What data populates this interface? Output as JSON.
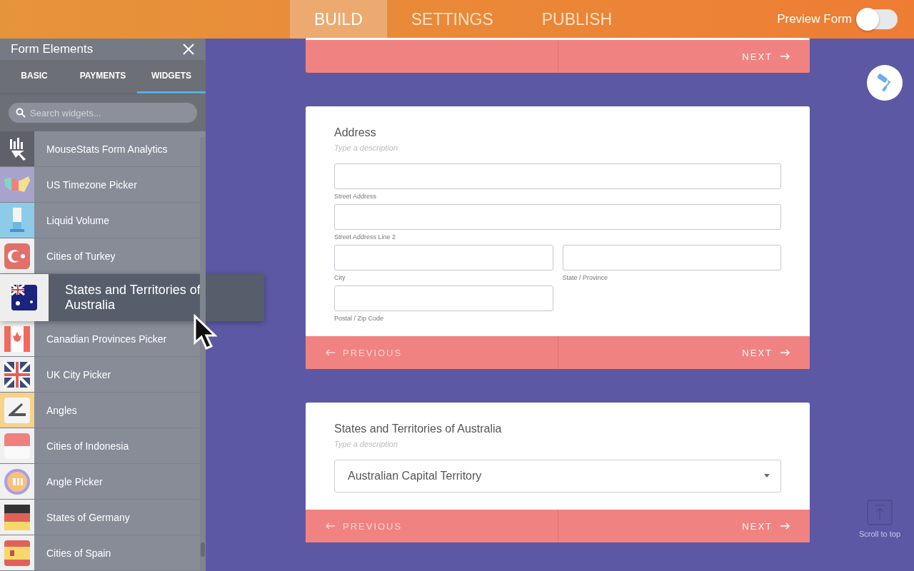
{
  "top_tabs": [
    {
      "label": "BUILD",
      "selected": true
    },
    {
      "label": "SETTINGS",
      "selected": false
    },
    {
      "label": "PUBLISH",
      "selected": false
    }
  ],
  "preview": {
    "label": "Preview Form",
    "on": false
  },
  "sidebar": {
    "title": "Form Elements",
    "tabs": [
      {
        "label": "BASIC",
        "selected": false
      },
      {
        "label": "PAYMENTS",
        "selected": false
      },
      {
        "label": "WIDGETS",
        "selected": true
      }
    ],
    "search": {
      "placeholder": "Search widgets..."
    },
    "items": [
      {
        "label": "MouseStats Form Analytics",
        "kind": "bars",
        "dragging": false
      },
      {
        "label": "US Timezone Picker",
        "kind": "usmap",
        "dragging": false
      },
      {
        "label": "Liquid Volume",
        "kind": "beaker",
        "dragging": false
      },
      {
        "label": "Cities of Turkey",
        "kind": "turkey",
        "dragging": false
      },
      {
        "label": "States and Territories of Australia",
        "kind": "australia",
        "dragging": true
      },
      {
        "label": "Canadian Provinces Picker",
        "kind": "canada",
        "dragging": false
      },
      {
        "label": "UK City Picker",
        "kind": "uk",
        "dragging": false
      },
      {
        "label": "Angles",
        "kind": "angle",
        "dragging": false
      },
      {
        "label": "Cities of Indonesia",
        "kind": "indonesia",
        "dragging": false
      },
      {
        "label": "Angle Picker",
        "kind": "degrees",
        "dragging": false
      },
      {
        "label": "States of Germany",
        "kind": "germany",
        "dragging": false
      },
      {
        "label": "Cities of Spain",
        "kind": "spain",
        "dragging": false
      }
    ]
  },
  "cards": [
    {
      "kind": "footer_only",
      "footer": {
        "next": "NEXT"
      }
    },
    {
      "kind": "address",
      "title": "Address",
      "description": "Type a description",
      "fields": [
        {
          "label": "Street Address",
          "kind": "full"
        },
        {
          "label": "Street Address Line 2",
          "kind": "full"
        },
        {
          "label": "City",
          "kind": "half"
        },
        {
          "label": "State / Province",
          "kind": "half"
        },
        {
          "label": "Postal / Zip Code",
          "kind": "half"
        }
      ],
      "footer": {
        "previous": "PREVIOUS",
        "next": "NEXT"
      }
    },
    {
      "kind": "dropdown",
      "title": "States and Territories of Australia",
      "description": "Type a description",
      "value": "Australian Capital Territory",
      "footer": {
        "previous": "PREVIOUS",
        "next": "NEXT"
      }
    }
  ],
  "scroll_top": {
    "label": "Scroll to top"
  }
}
